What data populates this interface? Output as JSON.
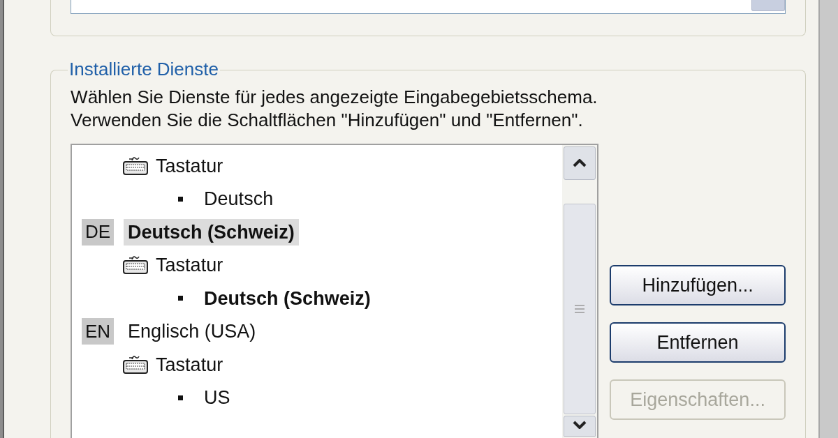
{
  "installed_services": {
    "title": "Installierte Dienste",
    "description": [
      "Wählen Sie Dienste für jedes angezeigte Eingabegebietsschema.",
      "Verwenden Sie die Schaltflächen \"Hinzufügen\" und \"Entfernen\"."
    ],
    "tree": [
      {
        "kind": "category",
        "label": "Tastatur",
        "children": [
          {
            "kind": "layout",
            "label": "Deutsch",
            "default": false
          }
        ]
      },
      {
        "kind": "language",
        "code": "DE",
        "label": "Deutsch (Schweiz)",
        "selected": true,
        "children": [
          {
            "kind": "category",
            "label": "Tastatur",
            "children": [
              {
                "kind": "layout",
                "label": "Deutsch (Schweiz)",
                "default": true
              }
            ]
          }
        ]
      },
      {
        "kind": "language",
        "code": "EN",
        "label": "Englisch (USA)",
        "selected": false,
        "children": [
          {
            "kind": "category",
            "label": "Tastatur",
            "children": [
              {
                "kind": "layout",
                "label": "US",
                "default": false
              }
            ]
          }
        ]
      }
    ],
    "buttons": [
      {
        "label": "Hinzufügen...",
        "disabled": false
      },
      {
        "label": "Entfernen",
        "disabled": false
      },
      {
        "label": "Eigenschaften...",
        "disabled": true
      }
    ]
  }
}
